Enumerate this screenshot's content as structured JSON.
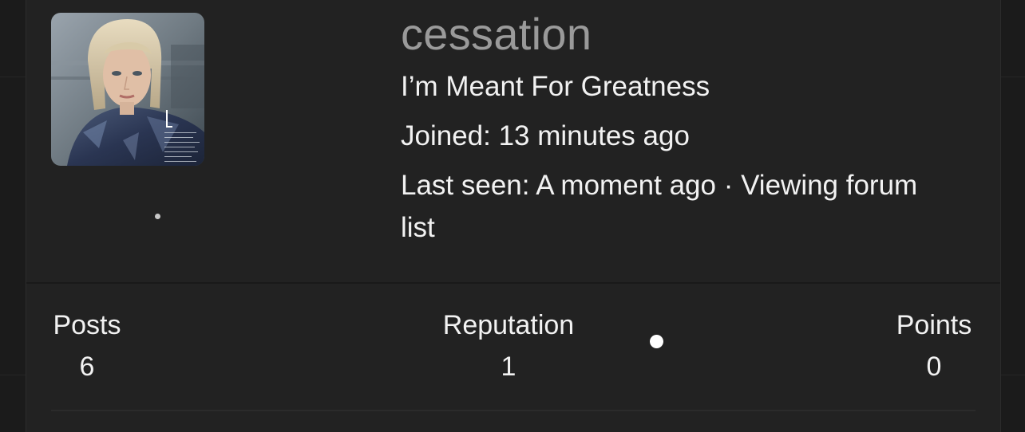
{
  "profile": {
    "username": "cessation",
    "custom_title": "I’m Meant For Greatness",
    "joined": "Joined: 13 minutes ago",
    "last_seen": "Last seen: A moment ago · Viewing forum list",
    "avatar_icon": "user-avatar-photo"
  },
  "stats": {
    "posts_label": "Posts",
    "posts_value": "6",
    "reputation_label": "Reputation",
    "reputation_value": "1",
    "points_label": "Points",
    "points_value": "0"
  },
  "colors": {
    "background": "#1b1b1b",
    "card": "#222222",
    "username": "#9a9a9a",
    "text": "#f2f2f2"
  }
}
